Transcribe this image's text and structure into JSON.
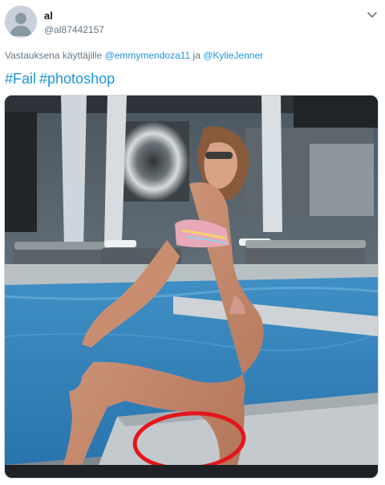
{
  "author": {
    "display_name": "al",
    "handle": "@al87442157"
  },
  "reply": {
    "prefix": "Vastauksena käyttäjille",
    "mention_1": "@emmymendoza11",
    "joiner": "ja",
    "mention_2": "@KylieJenner"
  },
  "tweet": {
    "hashtag_1": "#Fail",
    "hashtag_2": "#photoshop"
  },
  "icons": {
    "avatar": "default-avatar-icon",
    "menu": "chevron-down-icon"
  },
  "colors": {
    "link": "#1b95e0",
    "secondary_text": "#657786",
    "highlight_circle": "#e3161b"
  }
}
